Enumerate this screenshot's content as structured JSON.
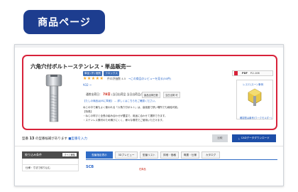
{
  "header": {
    "title": "商品ページ"
  },
  "product": {
    "title": "六角穴付ボルトーステンレス・単品販売ー",
    "badges": [
      "単品 (不) 個別",
      "フロックス"
    ],
    "stars": "★★★★★",
    "rating_meta": "件の評価数 4.5",
    "review_link": "→この商品のレビューを見る(50件)",
    "price": "¥32 ~",
    "shipping_label": "通常出荷日",
    "shipping_days": "78日",
    "shipping_rest": "(当日出荷品 当日出荷品/当日出荷可)",
    "ship_box_a": "製品出荷日数",
    "ship_box_b": "当日出荷 可",
    "desc_link": "【たしの商品はJISに準拠】 … 詳しくはこちらをご確認ください。",
    "desc_lines": [
      "ねじの中で最もよく使われる「六角穴付ボルト」は、高強度で狭い場所でも締結可能。",
      "【特長】",
      "・ねじの呼びと全長の組み合わせが豊富で、用途に合わせて選択できます。",
      "・ステンレス素材のため錆びにくく、様々な環境でご使用いただけます。"
    ],
    "pdf": {
      "label": "PDF",
      "code": "P.2-106"
    },
    "side": {
      "title": "レスエ(スー) 事例",
      "link": "確認型は番号(ワークモルダー)"
    }
  },
  "spec": {
    "label": "型番",
    "count": "13",
    "suffix": "の型番候補があります",
    "link": "■型番を入力",
    "small_button": "比較",
    "download": "CADデータダウンロード"
  },
  "filter": {
    "title": "絞り込み条件",
    "clear": "すべて解除",
    "rows": [
      "",
      "仕様・寸法で絞り込む"
    ]
  },
  "tabs": [
    "型番指定表示",
    "3Dプレビュー",
    "型番リスト",
    "詳細・価格",
    "概要・仕様",
    "カタログ"
  ],
  "content": {
    "scb": "SCB",
    "stock": "在庫品"
  },
  "colors": {
    "accent": "#1d3d8f",
    "highlight": "#d8223a",
    "link": "#2a66c9"
  }
}
